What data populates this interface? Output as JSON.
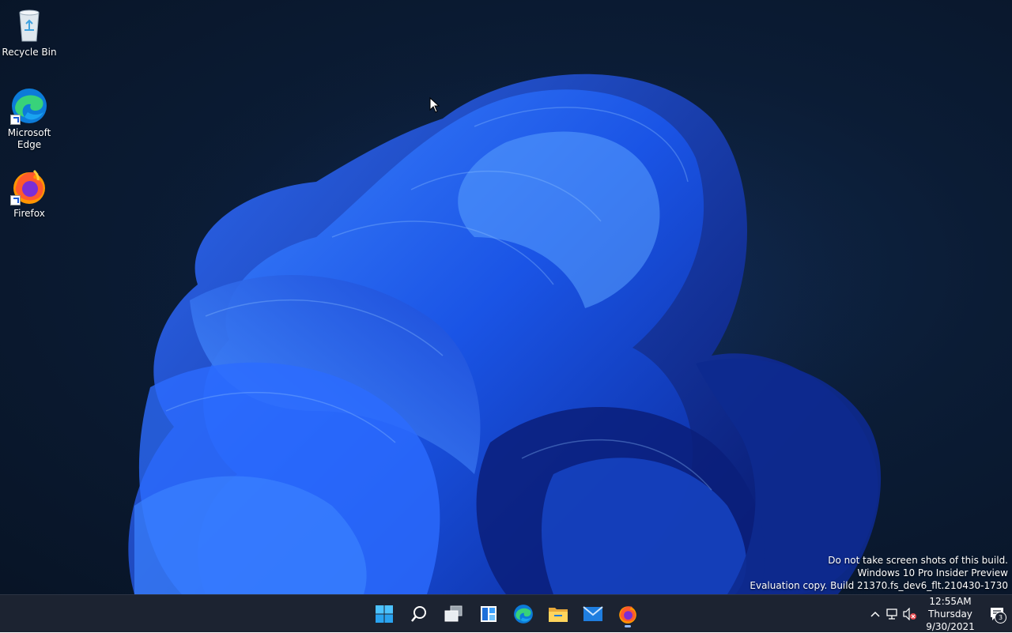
{
  "desktop": {
    "icons": [
      {
        "label": "Recycle Bin",
        "icon": "recycle-bin-icon"
      },
      {
        "label": "Microsoft Edge",
        "icon": "edge-icon"
      },
      {
        "label": "Firefox",
        "icon": "firefox-icon"
      }
    ],
    "watermark": {
      "line1": "Do not take screen shots of this build.",
      "line2": "Windows 10 Pro Insider Preview",
      "line3": "Evaluation copy. Build 21370.fs_dev6_flt.210430-1730"
    }
  },
  "taskbar": {
    "apps": [
      {
        "icon": "start-icon"
      },
      {
        "icon": "search-icon"
      },
      {
        "icon": "task-view-icon"
      },
      {
        "icon": "widgets-icon"
      },
      {
        "icon": "edge-icon"
      },
      {
        "icon": "file-explorer-icon"
      },
      {
        "icon": "mail-icon"
      },
      {
        "icon": "firefox-icon",
        "active": true
      }
    ],
    "tray": {
      "time": "12:55AM",
      "day": "Thursday",
      "date": "9/30/2021",
      "notification_count": "3"
    }
  },
  "colors": {
    "taskbar_bg": "#1c2331",
    "wallpaper_bloom": "#1a55e8",
    "desktop_bg": "#0b1c35"
  }
}
